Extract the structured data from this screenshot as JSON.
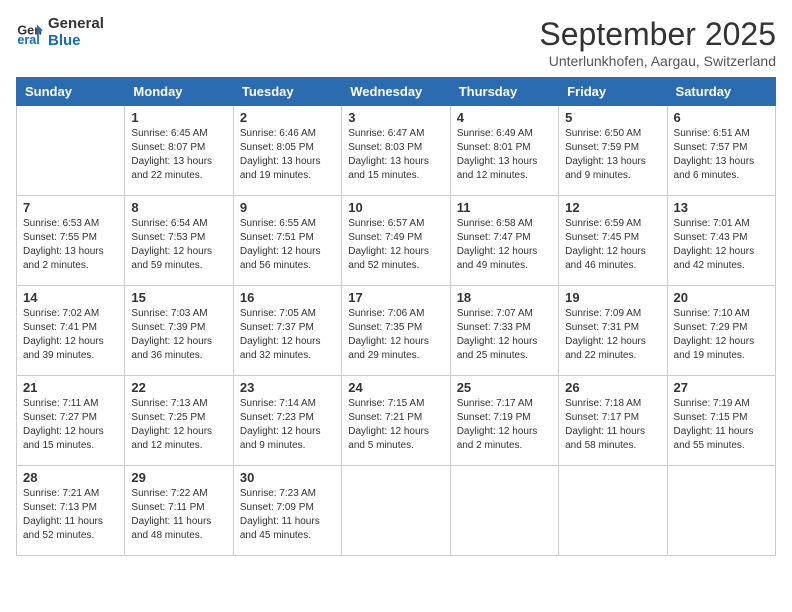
{
  "logo": {
    "line1": "General",
    "line2": "Blue"
  },
  "title": "September 2025",
  "location": "Unterlunkhofen, Aargau, Switzerland",
  "days_header": [
    "Sunday",
    "Monday",
    "Tuesday",
    "Wednesday",
    "Thursday",
    "Friday",
    "Saturday"
  ],
  "weeks": [
    [
      {
        "day": "",
        "info": ""
      },
      {
        "day": "1",
        "info": "Sunrise: 6:45 AM\nSunset: 8:07 PM\nDaylight: 13 hours\nand 22 minutes."
      },
      {
        "day": "2",
        "info": "Sunrise: 6:46 AM\nSunset: 8:05 PM\nDaylight: 13 hours\nand 19 minutes."
      },
      {
        "day": "3",
        "info": "Sunrise: 6:47 AM\nSunset: 8:03 PM\nDaylight: 13 hours\nand 15 minutes."
      },
      {
        "day": "4",
        "info": "Sunrise: 6:49 AM\nSunset: 8:01 PM\nDaylight: 13 hours\nand 12 minutes."
      },
      {
        "day": "5",
        "info": "Sunrise: 6:50 AM\nSunset: 7:59 PM\nDaylight: 13 hours\nand 9 minutes."
      },
      {
        "day": "6",
        "info": "Sunrise: 6:51 AM\nSunset: 7:57 PM\nDaylight: 13 hours\nand 6 minutes."
      }
    ],
    [
      {
        "day": "7",
        "info": "Sunrise: 6:53 AM\nSunset: 7:55 PM\nDaylight: 13 hours\nand 2 minutes."
      },
      {
        "day": "8",
        "info": "Sunrise: 6:54 AM\nSunset: 7:53 PM\nDaylight: 12 hours\nand 59 minutes."
      },
      {
        "day": "9",
        "info": "Sunrise: 6:55 AM\nSunset: 7:51 PM\nDaylight: 12 hours\nand 56 minutes."
      },
      {
        "day": "10",
        "info": "Sunrise: 6:57 AM\nSunset: 7:49 PM\nDaylight: 12 hours\nand 52 minutes."
      },
      {
        "day": "11",
        "info": "Sunrise: 6:58 AM\nSunset: 7:47 PM\nDaylight: 12 hours\nand 49 minutes."
      },
      {
        "day": "12",
        "info": "Sunrise: 6:59 AM\nSunset: 7:45 PM\nDaylight: 12 hours\nand 46 minutes."
      },
      {
        "day": "13",
        "info": "Sunrise: 7:01 AM\nSunset: 7:43 PM\nDaylight: 12 hours\nand 42 minutes."
      }
    ],
    [
      {
        "day": "14",
        "info": "Sunrise: 7:02 AM\nSunset: 7:41 PM\nDaylight: 12 hours\nand 39 minutes."
      },
      {
        "day": "15",
        "info": "Sunrise: 7:03 AM\nSunset: 7:39 PM\nDaylight: 12 hours\nand 36 minutes."
      },
      {
        "day": "16",
        "info": "Sunrise: 7:05 AM\nSunset: 7:37 PM\nDaylight: 12 hours\nand 32 minutes."
      },
      {
        "day": "17",
        "info": "Sunrise: 7:06 AM\nSunset: 7:35 PM\nDaylight: 12 hours\nand 29 minutes."
      },
      {
        "day": "18",
        "info": "Sunrise: 7:07 AM\nSunset: 7:33 PM\nDaylight: 12 hours\nand 25 minutes."
      },
      {
        "day": "19",
        "info": "Sunrise: 7:09 AM\nSunset: 7:31 PM\nDaylight: 12 hours\nand 22 minutes."
      },
      {
        "day": "20",
        "info": "Sunrise: 7:10 AM\nSunset: 7:29 PM\nDaylight: 12 hours\nand 19 minutes."
      }
    ],
    [
      {
        "day": "21",
        "info": "Sunrise: 7:11 AM\nSunset: 7:27 PM\nDaylight: 12 hours\nand 15 minutes."
      },
      {
        "day": "22",
        "info": "Sunrise: 7:13 AM\nSunset: 7:25 PM\nDaylight: 12 hours\nand 12 minutes."
      },
      {
        "day": "23",
        "info": "Sunrise: 7:14 AM\nSunset: 7:23 PM\nDaylight: 12 hours\nand 9 minutes."
      },
      {
        "day": "24",
        "info": "Sunrise: 7:15 AM\nSunset: 7:21 PM\nDaylight: 12 hours\nand 5 minutes."
      },
      {
        "day": "25",
        "info": "Sunrise: 7:17 AM\nSunset: 7:19 PM\nDaylight: 12 hours\nand 2 minutes."
      },
      {
        "day": "26",
        "info": "Sunrise: 7:18 AM\nSunset: 7:17 PM\nDaylight: 11 hours\nand 58 minutes."
      },
      {
        "day": "27",
        "info": "Sunrise: 7:19 AM\nSunset: 7:15 PM\nDaylight: 11 hours\nand 55 minutes."
      }
    ],
    [
      {
        "day": "28",
        "info": "Sunrise: 7:21 AM\nSunset: 7:13 PM\nDaylight: 11 hours\nand 52 minutes."
      },
      {
        "day": "29",
        "info": "Sunrise: 7:22 AM\nSunset: 7:11 PM\nDaylight: 11 hours\nand 48 minutes."
      },
      {
        "day": "30",
        "info": "Sunrise: 7:23 AM\nSunset: 7:09 PM\nDaylight: 11 hours\nand 45 minutes."
      },
      {
        "day": "",
        "info": ""
      },
      {
        "day": "",
        "info": ""
      },
      {
        "day": "",
        "info": ""
      },
      {
        "day": "",
        "info": ""
      }
    ]
  ]
}
